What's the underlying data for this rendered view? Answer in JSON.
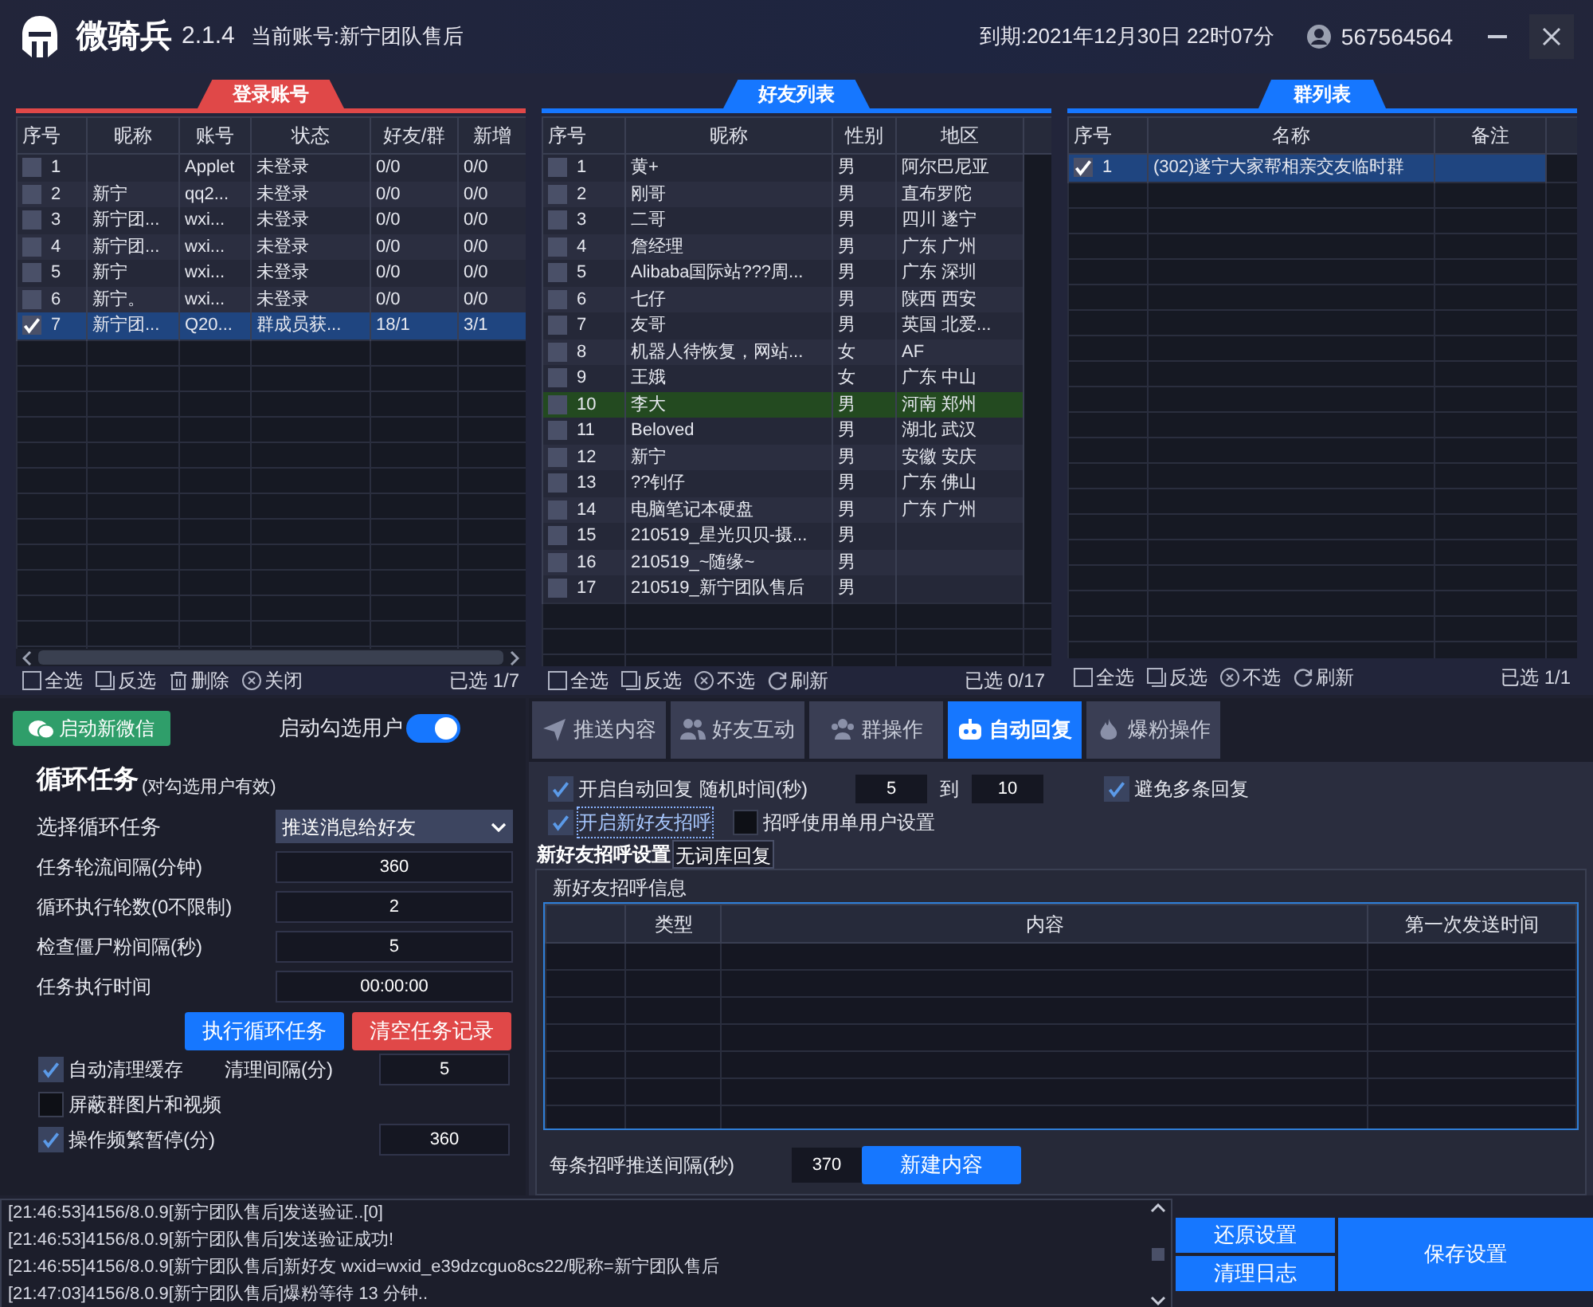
{
  "app": {
    "name": "微骑兵",
    "version": "2.1.4",
    "current_account": "当前账号:新宁团队售后",
    "expiry": "到期:2021年12月30日 22时07分",
    "user_id": "567564564"
  },
  "accounts": {
    "title": "登录账号",
    "columns": [
      "序号",
      "昵称",
      "账号",
      "状态",
      "好友/群",
      "新增"
    ],
    "rows": [
      {
        "cells": [
          "1",
          "",
          "Applet",
          "未登录",
          "0/0",
          "0/0"
        ],
        "checked": false,
        "selected": false
      },
      {
        "cells": [
          "2",
          "新宁",
          "qq2...",
          "未登录",
          "0/0",
          "0/0"
        ],
        "checked": false,
        "selected": false
      },
      {
        "cells": [
          "3",
          "新宁团...",
          "wxi...",
          "未登录",
          "0/0",
          "0/0"
        ],
        "checked": false,
        "selected": false
      },
      {
        "cells": [
          "4",
          "新宁团...",
          "wxi...",
          "未登录",
          "0/0",
          "0/0"
        ],
        "checked": false,
        "selected": false
      },
      {
        "cells": [
          "5",
          "新宁",
          "wxi...",
          "未登录",
          "0/0",
          "0/0"
        ],
        "checked": false,
        "selected": false
      },
      {
        "cells": [
          "6",
          "新宁。",
          "wxi...",
          "未登录",
          "0/0",
          "0/0"
        ],
        "checked": false,
        "selected": false
      },
      {
        "cells": [
          "7",
          "新宁团...",
          "Q20...",
          "群成员获...",
          "18/1",
          "3/1"
        ],
        "checked": true,
        "selected": true
      }
    ],
    "actions": [
      "全选",
      "反选",
      "删除",
      "关闭"
    ],
    "selected_count": "已选 1/7"
  },
  "friends": {
    "title": "好友列表",
    "columns": [
      "序号",
      "昵称",
      "性别",
      "地区"
    ],
    "rows": [
      {
        "cells": [
          "1",
          "黄+",
          "男",
          "阿尔巴尼亚"
        ],
        "checked": false,
        "highlighted": false
      },
      {
        "cells": [
          "2",
          "刚哥",
          "男",
          "直布罗陀"
        ],
        "checked": false,
        "highlighted": false
      },
      {
        "cells": [
          "3",
          "二哥",
          "男",
          "四川 遂宁"
        ],
        "checked": false,
        "highlighted": false
      },
      {
        "cells": [
          "4",
          "詹经理",
          "男",
          "广东 广州"
        ],
        "checked": false,
        "highlighted": false
      },
      {
        "cells": [
          "5",
          "Alibaba国际站???周...",
          "男",
          "广东 深圳"
        ],
        "checked": false,
        "highlighted": false
      },
      {
        "cells": [
          "6",
          "七仔",
          "男",
          "陕西 西安"
        ],
        "checked": false,
        "highlighted": false
      },
      {
        "cells": [
          "7",
          "友哥",
          "男",
          "英国 北爱..."
        ],
        "checked": false,
        "highlighted": false
      },
      {
        "cells": [
          "8",
          "机器人待恢复，网站...",
          "女",
          "AF"
        ],
        "checked": false,
        "highlighted": false
      },
      {
        "cells": [
          "9",
          "王娥",
          "女",
          "广东 中山"
        ],
        "checked": false,
        "highlighted": false
      },
      {
        "cells": [
          "10",
          "李大",
          "男",
          "河南 郑州"
        ],
        "checked": false,
        "highlighted": true
      },
      {
        "cells": [
          "11",
          "Beloved",
          "男",
          "湖北 武汉"
        ],
        "checked": false,
        "highlighted": false
      },
      {
        "cells": [
          "12",
          "新宁",
          "男",
          "安徽 安庆"
        ],
        "checked": false,
        "highlighted": false
      },
      {
        "cells": [
          "13",
          "??钊仔",
          "男",
          "广东 佛山"
        ],
        "checked": false,
        "highlighted": false
      },
      {
        "cells": [
          "14",
          "电脑笔记本硬盘",
          "男",
          "广东 广州"
        ],
        "checked": false,
        "highlighted": false
      },
      {
        "cells": [
          "15",
          "210519_星光贝贝-摄...",
          "男",
          ""
        ],
        "checked": false,
        "highlighted": false
      },
      {
        "cells": [
          "16",
          "210519_~随缘~",
          "男",
          ""
        ],
        "checked": false,
        "highlighted": false
      },
      {
        "cells": [
          "17",
          "210519_新宁团队售后",
          "男",
          ""
        ],
        "checked": false,
        "highlighted": false
      }
    ],
    "actions": [
      "全选",
      "反选",
      "不选",
      "刷新"
    ],
    "selected_count": "已选 0/17"
  },
  "groups": {
    "title": "群列表",
    "columns": [
      "序号",
      "名称",
      "备注"
    ],
    "rows": [
      {
        "cells": [
          "1",
          "(302)遂宁大家帮相亲交友临时群",
          ""
        ],
        "checked": true,
        "selected": true
      }
    ],
    "actions": [
      "全选",
      "反选",
      "不选",
      "刷新"
    ],
    "selected_count": "已选 1/1"
  },
  "launch_button": "启动新微信",
  "auto_start": {
    "label": "启动勾选用户",
    "on": true
  },
  "loop_task": {
    "title": "循环任务",
    "subtitle": "(对勾选用户有效)",
    "select": {
      "label": "选择循环任务",
      "value": "推送消息给好友"
    },
    "fields": [
      {
        "label": "任务轮流间隔(分钟)",
        "value": "360"
      },
      {
        "label": "循环执行轮数(0不限制)",
        "value": "2"
      },
      {
        "label": "检查僵尸粉间隔(秒)",
        "value": "5"
      },
      {
        "label": "任务执行时间",
        "value": "00:00:00"
      }
    ],
    "run_button": "执行循环任务",
    "clear_button": "清空任务记录",
    "options": [
      {
        "label": "自动清理缓存",
        "checked": true,
        "field_label": "清理间隔(分)",
        "value": "5"
      },
      {
        "label": "屏蔽群图片和视频",
        "checked": false
      },
      {
        "label": "操作频繁暂停(分)",
        "checked": true,
        "value": "360"
      }
    ]
  },
  "tabs": [
    {
      "label": "推送内容",
      "selected": false
    },
    {
      "label": "好友互动",
      "selected": false
    },
    {
      "label": "群操作",
      "selected": false
    },
    {
      "label": "自动回复",
      "selected": true
    },
    {
      "label": "爆粉操作",
      "selected": false
    }
  ],
  "auto_reply": {
    "enable": {
      "label": "开启自动回复",
      "checked": true
    },
    "random_label": "随机时间(秒)",
    "min": "5",
    "to": "到",
    "max": "10",
    "avoid": {
      "label": "避免多条回复",
      "checked": true
    },
    "greet": {
      "label": "开启新好友招呼",
      "checked": true
    },
    "single_user": {
      "label": "招呼使用单用户设置",
      "checked": false
    },
    "subtabs": [
      {
        "label": "新好友招呼设置",
        "selected": true
      },
      {
        "label": "无词库回复",
        "selected": false
      }
    ],
    "group_title": "新好友招呼信息",
    "columns": [
      "类型",
      "内容",
      "第一次发送时间"
    ],
    "interval_label": "每条招呼推送间隔(秒)",
    "interval": "370",
    "new_button": "新建内容"
  },
  "log": [
    "[21:46:53]4156/8.0.9[新宁团队售后]发送验证..[0]",
    "[21:46:53]4156/8.0.9[新宁团队售后]发送验证成功!",
    "[21:46:55]4156/8.0.9[新宁团队售后]新好友 wxid=wxid_e39dzcguo8cs22/昵称=新宁团队售后",
    "[21:47:03]4156/8.0.9[新宁团队售后]爆粉等待 13 分钟.."
  ],
  "log_buttons": {
    "restore": "还原设置",
    "clear": "清理日志",
    "save": "保存设置"
  }
}
